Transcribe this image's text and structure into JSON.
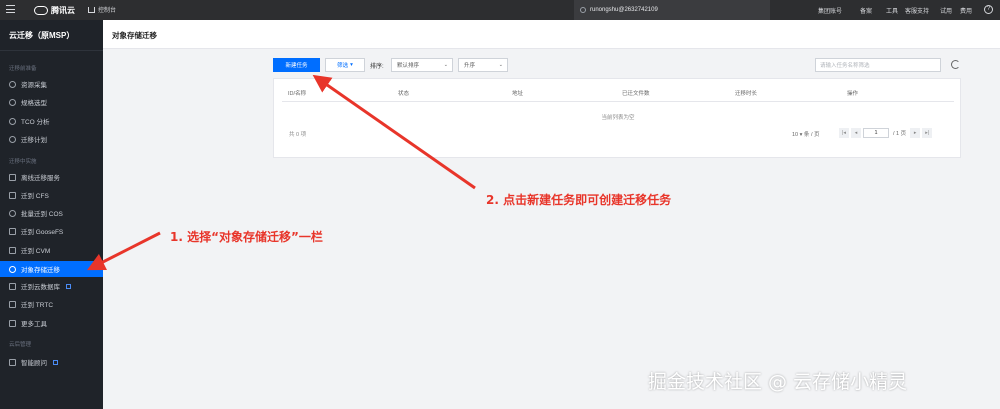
{
  "topbar": {
    "brand": "腾讯云",
    "console": "控制台",
    "account": "runongshu@2632742109",
    "nav": [
      "集团账号",
      "备案",
      "工具",
      "客服支持",
      "试用",
      "费用"
    ]
  },
  "sidebar": {
    "title": "云迁移（原MSP）",
    "sections": [
      "迁移前准备",
      "迁移中实施",
      "云后管理"
    ],
    "items_pre": [
      "资源采集",
      "规格选型",
      "TCO 分析",
      "迁移计划"
    ],
    "items_mid": [
      "离线迁移服务",
      "迁到 CFS",
      "批量迁到 COS",
      "迁到 GooseFS",
      "迁到 CVM",
      "对象存储迁移",
      "迁到云数据库",
      "迁到 TRTC",
      "更多工具"
    ],
    "items_post": [
      "智能顾问"
    ]
  },
  "page": {
    "title": "对象存储迁移"
  },
  "toolbar": {
    "new_task": "新建任务",
    "filter": "筛选",
    "sort_label": "排序:",
    "sort_value": "默认排序",
    "order_value": "升序",
    "search_placeholder": "请输入任务名称筛选"
  },
  "table": {
    "columns": [
      "ID/名称",
      "状态",
      "地址",
      "已迁文件数",
      "迁移时长",
      "操作"
    ],
    "empty_text": "当前列表为空",
    "total": "共 0 项",
    "page_size": "10 ▾ 条 / 页",
    "page_value": "1",
    "page_total": "/ 1 页"
  },
  "annotations": {
    "step1": "1. 选择“对象存储迁移”一栏",
    "step2": "2. 点击新建任务即可创建迁移任务",
    "watermark": "掘金技术社区 @ 云存储小精灵"
  },
  "colors": {
    "primary": "#006eff",
    "annotation": "#e8352a",
    "sidebar_bg": "#1f2329"
  }
}
